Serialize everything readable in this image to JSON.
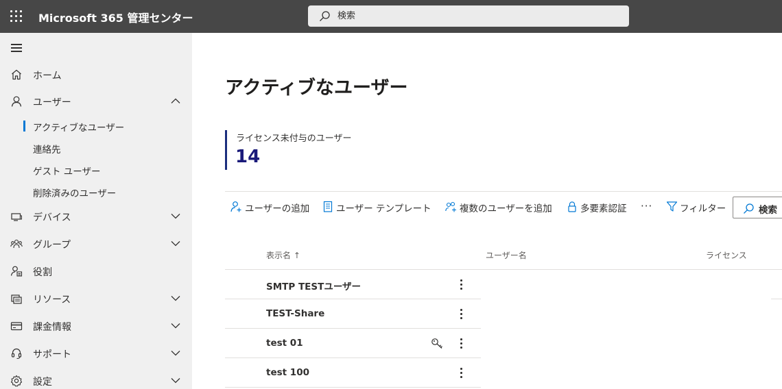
{
  "header": {
    "app_title": "Microsoft 365 管理センター",
    "search_placeholder": "検索",
    "bg_color": "#474747",
    "icons": {
      "launcher": "waffle-icon",
      "search": "search-icon"
    }
  },
  "sidebar": {
    "bg_color": "#f0f0f0",
    "items": [
      {
        "label": "ホーム",
        "icon": "home-icon"
      },
      {
        "label": "ユーザー",
        "icon": "person-icon",
        "expanded": true
      },
      {
        "label": "デバイス",
        "icon": "device-icon",
        "expanded": false
      },
      {
        "label": "グループ",
        "icon": "group-icon",
        "expanded": false
      },
      {
        "label": "役割",
        "icon": "role-icon"
      },
      {
        "label": "リソース",
        "icon": "resources-icon",
        "expanded": false
      },
      {
        "label": "課金情報",
        "icon": "billing-icon",
        "expanded": false
      },
      {
        "label": "サポート",
        "icon": "headset-icon",
        "expanded": false
      },
      {
        "label": "設定",
        "icon": "gear-icon",
        "expanded": false
      }
    ],
    "user_subitems": [
      {
        "label": "アクティブなユーザー",
        "active": true
      },
      {
        "label": "連絡先"
      },
      {
        "label": "ゲスト ユーザー"
      },
      {
        "label": "削除済みのユーザー"
      }
    ],
    "accent_color": "#0078d4"
  },
  "main": {
    "page_title": "アクティブなユーザー",
    "kpi": {
      "label": "ライセンス未付与のユーザー",
      "value": "14",
      "accent_color": "#1a2e7d"
    },
    "toolbar": {
      "add_user": "ユーザーの追加",
      "user_template": "ユーザー テンプレート",
      "add_multiple": "複数のユーザーを追加",
      "mfa": "多要素認証",
      "more": "···",
      "filter": "フィルター",
      "search": "検索"
    },
    "table": {
      "columns": [
        "表示名 ↑",
        "ユーザー名",
        "ライセンス"
      ],
      "rows": [
        {
          "display_name": "SMTP TESTユーザー",
          "has_key": false
        },
        {
          "display_name": "TEST-Share",
          "has_key": false
        },
        {
          "display_name": "test 01",
          "has_key": true
        },
        {
          "display_name": "test 100",
          "has_key": false
        }
      ]
    }
  }
}
